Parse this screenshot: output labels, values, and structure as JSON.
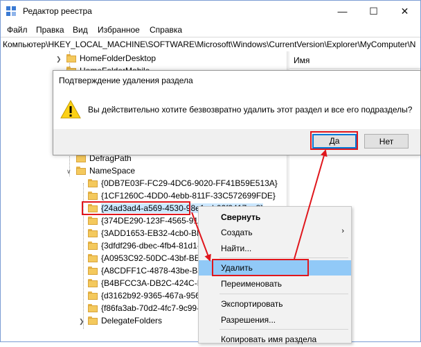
{
  "window": {
    "title": "Редактор реестра",
    "minimize_glyph": "—",
    "maximize_glyph": "☐",
    "close_glyph": "✕"
  },
  "menu": [
    "Файл",
    "Правка",
    "Вид",
    "Избранное",
    "Справка"
  ],
  "address": "Компьютер\\HKEY_LOCAL_MACHINE\\SOFTWARE\\Microsoft\\Windows\\CurrentVersion\\Explorer\\MyComputer\\N",
  "tree": {
    "top_items": [
      "HomeFolderDesktop",
      "HomeFolderMobile"
    ],
    "defrag_path": "DefragPath",
    "namespace": "NameSpace",
    "namespace_children": [
      "{0DB7E03F-FC29-4DC6-9020-FF41B59E513A}",
      "{1CF1260C-4DD0-4ebb-811F-33C572699FDE}",
      "{24ad3ad4-a569-4530-98e1-ab02f9417aa8}",
      "{374DE290-123F-4565-9164-39C4925E467B}",
      "{3ADD1653-EB32-4cb0-BBD7-DFA0ABB5ACCA}",
      "{3dfdf296-dbec-4fb4-81d1-6a3438bcf4de}",
      "{A0953C92-50DC-43bf-BE83-3742FED03C9C}",
      "{A8CDFF1C-4878-43be-B5FD-F8091C1C60D0}",
      "{B4BFCC3A-DB2C-424C-B029-7FE99A87C641}",
      "{d3162b92-9365-467a-956b-92703aca08af}",
      "{f86fa3ab-70d2-4fc7-9c99-fcbf05467f3a}"
    ],
    "delegate_folders": "DelegateFolders"
  },
  "right_pane": {
    "column_name": "Имя"
  },
  "dialog": {
    "title": "Подтверждение удаления раздела",
    "message": "Вы действительно хотите безвозвратно удалить этот раздел и все его подразделы?",
    "yes": "Да",
    "no": "Нет"
  },
  "context_menu": {
    "collapse": "Свернуть",
    "create": "Создать",
    "create_arrow": "›",
    "find": "Найти...",
    "delete": "Удалить",
    "rename": "Переименовать",
    "export": "Экспортировать",
    "permissions": "Разрешения...",
    "copy_name": "Копировать имя раздела"
  },
  "colors": {
    "annotation": "#e0161c",
    "accent": "#0078d7",
    "highlight": "#91c9f7"
  }
}
